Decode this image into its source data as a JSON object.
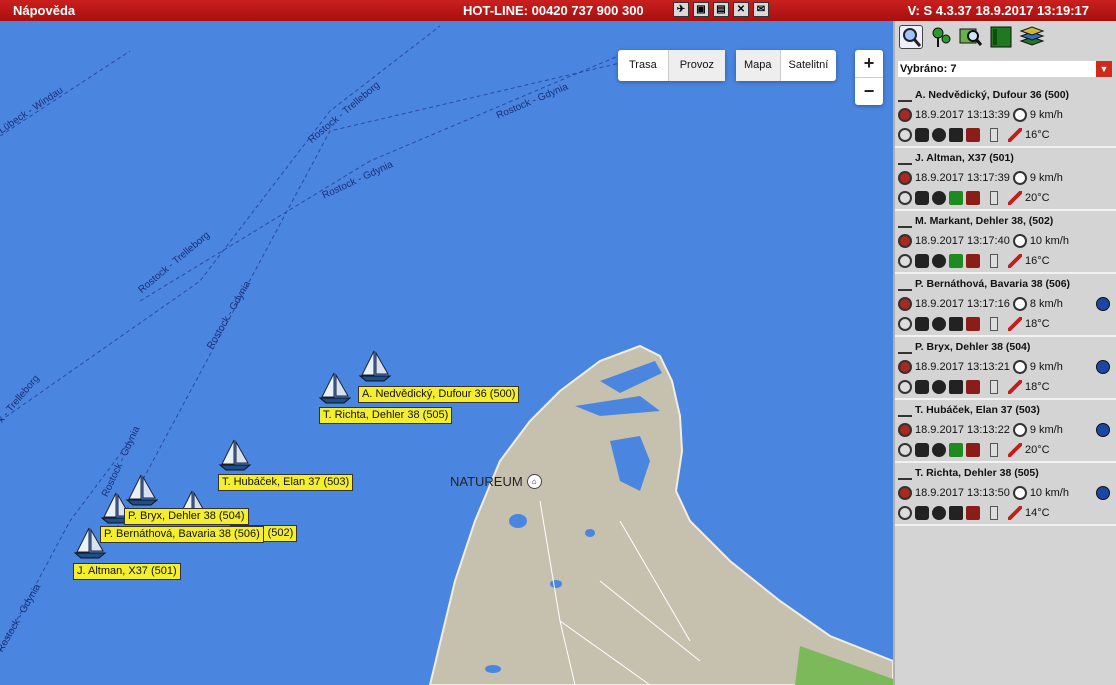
{
  "topbar": {
    "help": "Nápověda",
    "hotline": "HOT-LINE: 00420 737 900 300",
    "version": "V: S 4.3.37   18.9.2017 13:19:17",
    "icons": [
      "plane-icon",
      "monitor-icon",
      "settings-icon",
      "tools-icon",
      "mail-icon"
    ]
  },
  "map": {
    "buttons": {
      "route": "Trasa",
      "traffic": "Provoz",
      "map": "Mapa",
      "satellite": "Satelitní"
    },
    "zoom": {
      "in": "+",
      "out": "−"
    },
    "place_label": "NATUREUM",
    "route_labels": [
      "Lübeck - Windau",
      "Rostock - Trelleborg",
      "Rostock - Gdynia",
      "Rostock - Gdynia",
      "Rostock - Trelleborg",
      "Rostock - Gdynia",
      "x - Trelleborg",
      "Rostock - Gdynia",
      "Rostock - Gdynia"
    ],
    "vessel_labels": [
      "A. Nedvědický, Dufour 36 (500)",
      "T. Richta, Dehler 38 (505)",
      "T. Hubáček, Elan 37 (503)",
      "P. Bryx, Dehler 38 (504)",
      "P. Bernáthová, Bavaria 38 (506)",
      "ler 38, (502)",
      "J. Altman, X37 (501)"
    ]
  },
  "panel": {
    "selected": "Vybráno: 7",
    "vessels": [
      {
        "name": "A. Nedvědický, Dufour 36 (500)",
        "time": "18.9.2017 13:13:39",
        "speed": "9 km/h",
        "temp": "16°C",
        "truck_color": "#222222",
        "globe": false
      },
      {
        "name": "J. Altman, X37 (501)",
        "time": "18.9.2017 13:17:39",
        "speed": "9 km/h",
        "temp": "20°C",
        "truck_color": "#1f8a1f",
        "globe": false
      },
      {
        "name": "M. Markant, Dehler 38, (502)",
        "time": "18.9.2017 13:17:40",
        "speed": "10 km/h",
        "temp": "16°C",
        "truck_color": "#1f8a1f",
        "globe": false
      },
      {
        "name": "P. Bernáthová, Bavaria 38 (506)",
        "time": "18.9.2017 13:17:16",
        "speed": "8 km/h",
        "temp": "18°C",
        "truck_color": "#222222",
        "globe": true
      },
      {
        "name": "P. Bryx, Dehler 38 (504)",
        "time": "18.9.2017 13:13:21",
        "speed": "9 km/h",
        "temp": "18°C",
        "truck_color": "#222222",
        "globe": true
      },
      {
        "name": "T. Hubáček, Elan 37 (503)",
        "time": "18.9.2017 13:13:22",
        "speed": "9 km/h",
        "temp": "20°C",
        "truck_color": "#1f8a1f",
        "globe": true
      },
      {
        "name": "T. Richta, Dehler 38 (505)",
        "time": "18.9.2017 13:13:50",
        "speed": "10 km/h",
        "temp": "14°C",
        "truck_color": "#222222",
        "globe": true
      }
    ]
  },
  "colors": {
    "sea": "#4a86e0",
    "land": "#c6c0ae",
    "forest": "#7cb95a",
    "label_bg": "#f4ee2d",
    "header": "#b3151a"
  }
}
